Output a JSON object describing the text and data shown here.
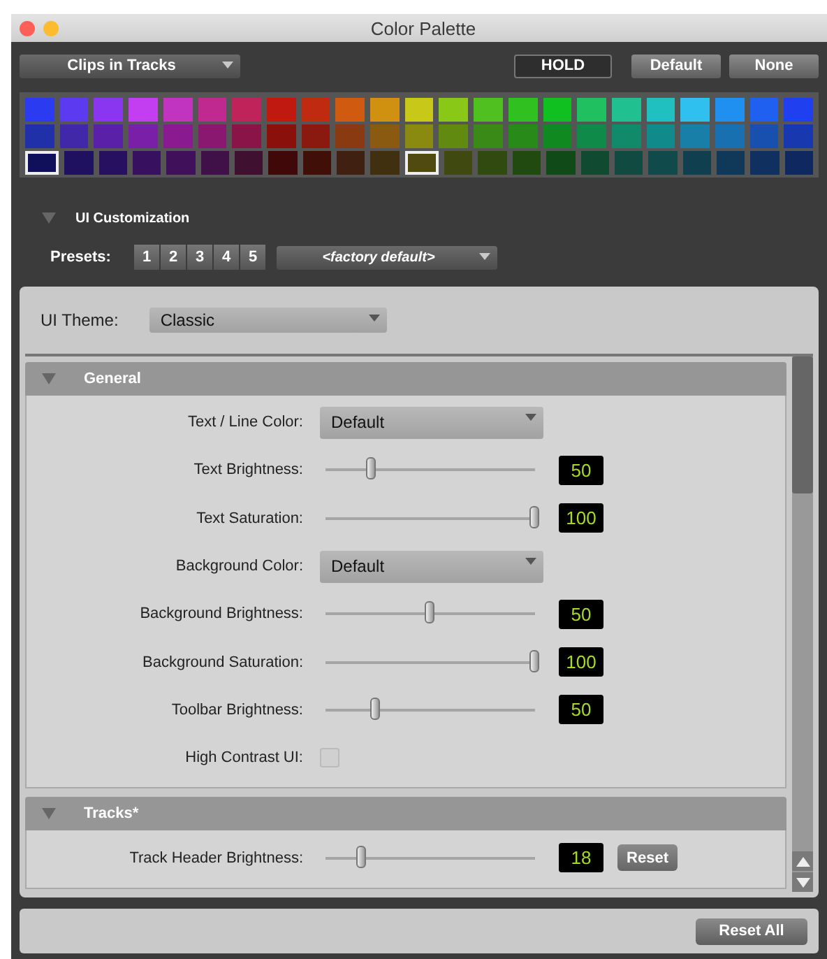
{
  "window": {
    "title": "Color Palette"
  },
  "target_menu": {
    "value": "Clips in Tracks"
  },
  "buttons": [
    {
      "label": "HOLD",
      "kind": "toggle"
    },
    {
      "label": "Default",
      "kind": "push"
    },
    {
      "label": "None",
      "kind": "push"
    }
  ],
  "palette": [
    [
      {
        "color": "#2b3cf0",
        "selected": false
      },
      {
        "color": "#5b3af0",
        "selected": false
      },
      {
        "color": "#8a35f0",
        "selected": false
      },
      {
        "color": "#c33ef0",
        "selected": false
      },
      {
        "color": "#c034c0",
        "selected": false
      },
      {
        "color": "#c02a90",
        "selected": false
      },
      {
        "color": "#c0225a",
        "selected": false
      },
      {
        "color": "#c01a10",
        "selected": false
      },
      {
        "color": "#c02a10",
        "selected": false
      },
      {
        "color": "#d05a10",
        "selected": false
      },
      {
        "color": "#d09010",
        "selected": false
      },
      {
        "color": "#c8c818",
        "selected": false
      },
      {
        "color": "#8ac818",
        "selected": false
      },
      {
        "color": "#50c020",
        "selected": false
      },
      {
        "color": "#30c020",
        "selected": false
      },
      {
        "color": "#10c020",
        "selected": false
      },
      {
        "color": "#20c060",
        "selected": false
      },
      {
        "color": "#20c090",
        "selected": false
      },
      {
        "color": "#20c0c0",
        "selected": false
      },
      {
        "color": "#30c0f0",
        "selected": false
      },
      {
        "color": "#2090f0",
        "selected": false
      },
      {
        "color": "#2060f0",
        "selected": false
      },
      {
        "color": "#2040f0",
        "selected": false
      }
    ],
    [
      {
        "color": "#2030a8",
        "selected": false
      },
      {
        "color": "#4028a8",
        "selected": false
      },
      {
        "color": "#5a20a8",
        "selected": false
      },
      {
        "color": "#7a20a8",
        "selected": false
      },
      {
        "color": "#8a1a90",
        "selected": false
      },
      {
        "color": "#8a1870",
        "selected": false
      },
      {
        "color": "#8a1448",
        "selected": false
      },
      {
        "color": "#8a100c",
        "selected": false
      },
      {
        "color": "#8a1a10",
        "selected": false
      },
      {
        "color": "#8a3a10",
        "selected": false
      },
      {
        "color": "#8a5a10",
        "selected": false
      },
      {
        "color": "#8a8a10",
        "selected": false
      },
      {
        "color": "#608a10",
        "selected": false
      },
      {
        "color": "#3a8a18",
        "selected": false
      },
      {
        "color": "#288a18",
        "selected": false
      },
      {
        "color": "#108a20",
        "selected": false
      },
      {
        "color": "#108a48",
        "selected": false
      },
      {
        "color": "#108a68",
        "selected": false
      },
      {
        "color": "#108a8a",
        "selected": false
      },
      {
        "color": "#1880a8",
        "selected": false
      },
      {
        "color": "#1870b0",
        "selected": false
      },
      {
        "color": "#1850b0",
        "selected": false
      },
      {
        "color": "#1838b0",
        "selected": false
      }
    ],
    [
      {
        "color": "#10105a",
        "selected": true
      },
      {
        "color": "#201060",
        "selected": false
      },
      {
        "color": "#281060",
        "selected": false
      },
      {
        "color": "#381060",
        "selected": false
      },
      {
        "color": "#40105a",
        "selected": false
      },
      {
        "color": "#401048",
        "selected": false
      },
      {
        "color": "#401030",
        "selected": false
      },
      {
        "color": "#400808",
        "selected": false
      },
      {
        "color": "#401008",
        "selected": false
      },
      {
        "color": "#402010",
        "selected": false
      },
      {
        "color": "#403010",
        "selected": false
      },
      {
        "color": "#504a10",
        "selected": true
      },
      {
        "color": "#404a10",
        "selected": false
      },
      {
        "color": "#304a10",
        "selected": false
      },
      {
        "color": "#204a10",
        "selected": false
      },
      {
        "color": "#104a18",
        "selected": false
      },
      {
        "color": "#104a30",
        "selected": false
      },
      {
        "color": "#104a40",
        "selected": false
      },
      {
        "color": "#104a4a",
        "selected": false
      },
      {
        "color": "#104050",
        "selected": false
      },
      {
        "color": "#103858",
        "selected": false
      },
      {
        "color": "#103060",
        "selected": false
      },
      {
        "color": "#102860",
        "selected": false
      }
    ]
  ],
  "ui_customization": {
    "title": "UI Customization",
    "expanded": true,
    "presets_label": "Presets:",
    "presets": [
      "1",
      "2",
      "3",
      "4",
      "5"
    ],
    "preset_menu": {
      "value": "<factory default>"
    }
  },
  "theme": {
    "label": "UI Theme:",
    "value": "Classic"
  },
  "sections": [
    {
      "title": "General",
      "expanded": true,
      "settings": [
        {
          "kind": "dropdown",
          "label": "Text / Line Color:",
          "value": "Default"
        },
        {
          "kind": "slider",
          "label": "Text Brightness:",
          "level": 0.22,
          "reading": "50"
        },
        {
          "kind": "slider",
          "label": "Text Saturation:",
          "level": 1,
          "reading": "100"
        },
        {
          "kind": "dropdown",
          "label": "Background Color:",
          "value": "Default"
        },
        {
          "kind": "slider",
          "label": "Background Brightness:",
          "level": 0.5,
          "reading": "50"
        },
        {
          "kind": "slider",
          "label": "Background Saturation:",
          "level": 1,
          "reading": "100"
        },
        {
          "kind": "slider",
          "label": "Toolbar Brightness:",
          "level": 0.24,
          "reading": "50"
        },
        {
          "kind": "checkbox",
          "label": "High Contrast UI:",
          "checked": false
        }
      ]
    },
    {
      "title": "Tracks*",
      "expanded": true,
      "settings": [
        {
          "kind": "slider",
          "label": "Track Header Brightness:",
          "level": 0.17,
          "reading": "18",
          "reset": "Reset"
        }
      ]
    }
  ],
  "reset_all": "Reset All"
}
